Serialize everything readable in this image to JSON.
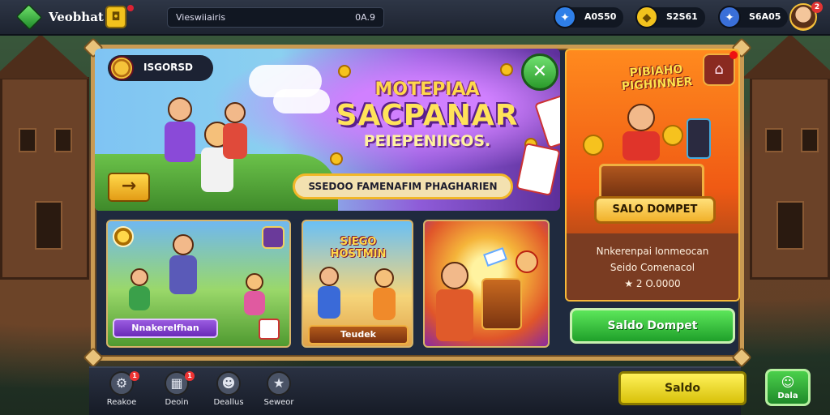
{
  "header": {
    "app_title": "Veobhat",
    "search_text": "Vieswiiairis",
    "search_value": "0A.9",
    "resources": [
      {
        "value": "A0S50",
        "icon": "plus-diamond-icon",
        "color": "#2f7fe8"
      },
      {
        "value": "S2S61",
        "icon": "gold-cube-icon",
        "color": "#f2c21d"
      },
      {
        "value": "S6A05",
        "icon": "plus-diamond-icon",
        "color": "#3a6fd8"
      }
    ],
    "notification_count": "2"
  },
  "hero": {
    "pill_label": "ISGORSD",
    "title_line1": "MOTEPIAA",
    "title_line2": "SACPANAR",
    "title_line3": "PEIEPENIIGOS.",
    "banner_text": "SSEDOO FAMENAFIM PHAGHARIEN",
    "arrow_icon": "→",
    "play_icon": "✕"
  },
  "side_panel": {
    "title": "PIBIAHO PIGHINNER",
    "bag_icon": "⌂",
    "button_label": "SALO DOMPET",
    "info_line1": "Nnkerenpai Ionmeocan",
    "info_line2": "Seido Comenacol",
    "info_amount": "★ 2 O.0000",
    "cta_label": "Saldo Dompet"
  },
  "game_cards": [
    {
      "label": "Nnakerelfhan"
    },
    {
      "title": "SIEGO HOSTMIN",
      "label": "Teudek"
    },
    {
      "title": ""
    }
  ],
  "bottom_nav": {
    "items": [
      {
        "label": "Reakoe",
        "icon": "⚙",
        "badge": "1"
      },
      {
        "label": "Deoin",
        "icon": "▦",
        "badge": "1"
      },
      {
        "label": "Deallus",
        "icon": "☻",
        "badge": ""
      },
      {
        "label": "Seweor",
        "icon": "★",
        "badge": ""
      }
    ],
    "saldo_label": "Saldo",
    "chat_label": "Dala",
    "chat_icon": "☺"
  }
}
